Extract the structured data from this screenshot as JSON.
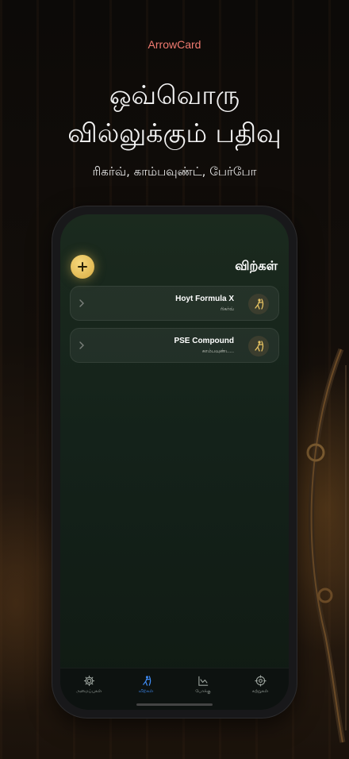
{
  "brand": "ArrowCard",
  "headline_line1": "ஒவ்வொரு",
  "headline_line2": "வில்லுக்கும் பதிவு",
  "tagline": "ரிகர்வ், காம்பவுண்ட், பேர்போ",
  "screen": {
    "title": "விற்கள்",
    "bows": [
      {
        "name": "Hoyt Formula X",
        "type": "ரிகர்வ்",
        "icon": "archer-icon"
      },
      {
        "name": "PSE Compound",
        "type": "காம்பவுண்ட...",
        "icon": "archer-icon"
      }
    ],
    "tabs": [
      {
        "label": "அமைப்புகள்",
        "icon": "gear-icon",
        "active": false
      },
      {
        "label": "விற்கள்",
        "icon": "archer-icon",
        "active": true
      },
      {
        "label": "போக்கு",
        "icon": "trend-chart-icon",
        "active": false
      },
      {
        "label": "சுற்றுகள்",
        "icon": "target-icon",
        "active": false
      }
    ]
  },
  "colors": {
    "brand": "#f07a70",
    "accent_gold": "#e6c262",
    "active_tab": "#3f8cf5"
  }
}
